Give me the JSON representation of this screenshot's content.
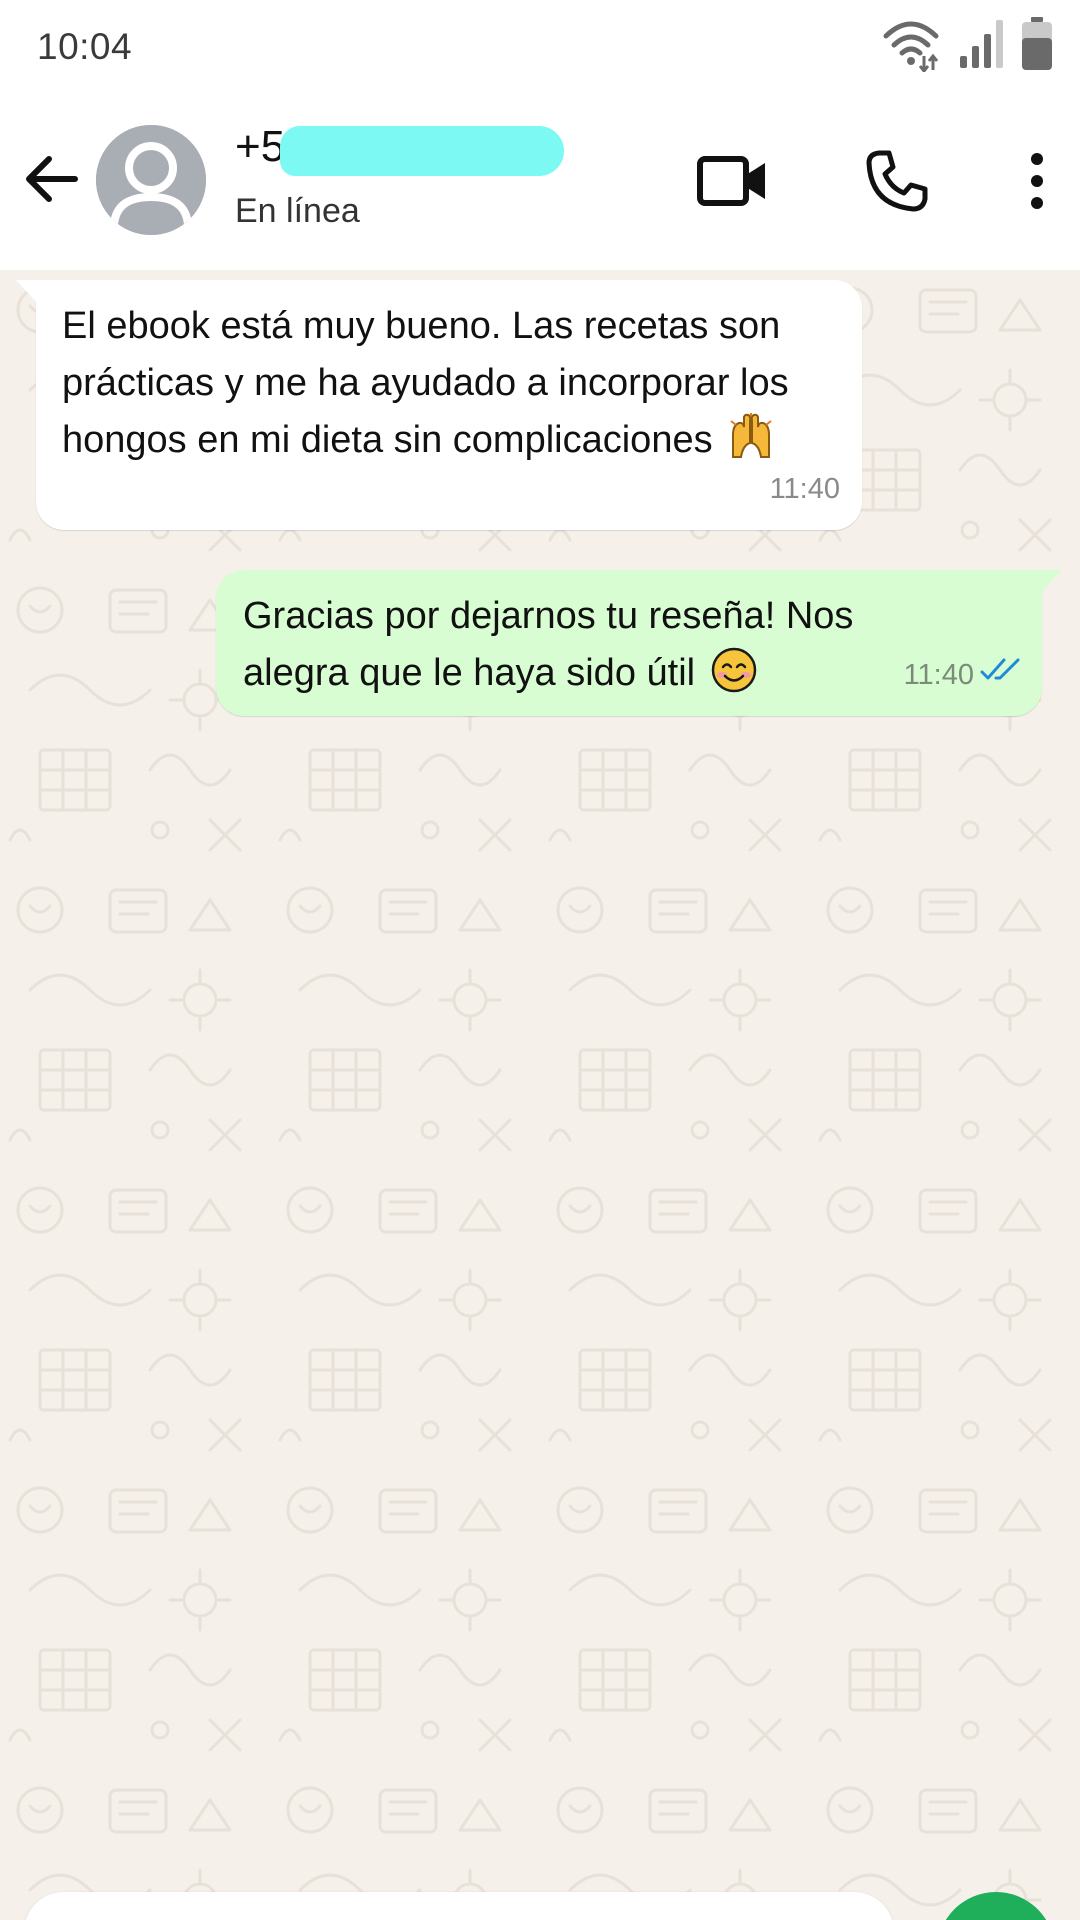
{
  "status_bar": {
    "time": "10:04",
    "icons": [
      "wifi-icon",
      "cellular-signal-icon",
      "battery-icon"
    ]
  },
  "header": {
    "contact_name": "+5",
    "contact_status": "En línea",
    "icons": {
      "back": "arrow-left-icon",
      "avatar": "default-avatar-icon",
      "video": "video-camera-icon",
      "call": "phone-icon",
      "menu": "more-vertical-icon"
    }
  },
  "messages": [
    {
      "direction": "incoming",
      "text": "El ebook está muy bueno. Las recetas son prácticas y me ha ayudado a incorporar los hongos en mi dieta sin complicaciones",
      "emoji": "raised-hands-emoji",
      "time": "11:40"
    },
    {
      "direction": "outgoing",
      "text": "Gracias por dejarnos tu reseña! Nos alegra que le haya sido útil",
      "emoji": "smiling-face-emoji",
      "time": "11:40",
      "status_icon": "double-check-read-icon"
    }
  ],
  "colors": {
    "incoming_bubble": "#ffffff",
    "outgoing_bubble": "#d9fdd3",
    "read_ticks": "#1f8bd8",
    "wallpaper": "#f5f0ea",
    "mic_button": "#1fae59",
    "redaction": "#7cf9f2"
  }
}
